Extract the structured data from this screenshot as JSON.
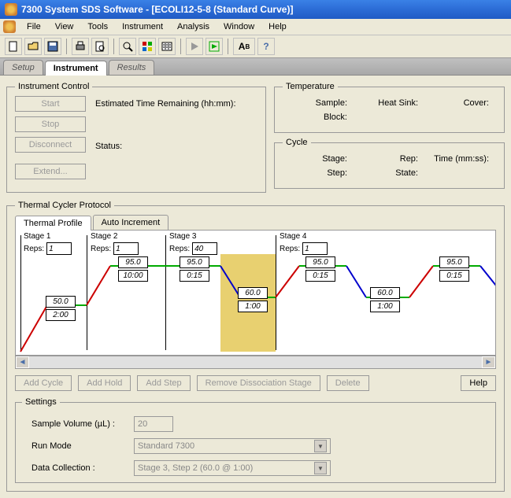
{
  "title": "7300 System SDS Software - [ECOLI12-5-8 (Standard Curve)]",
  "menu": [
    "File",
    "View",
    "Tools",
    "Instrument",
    "Analysis",
    "Window",
    "Help"
  ],
  "tabs": {
    "setup": "Setup",
    "instrument": "Instrument",
    "results": "Results"
  },
  "instctrl": {
    "legend": "Instrument Control",
    "start": "Start",
    "stop": "Stop",
    "disconnect": "Disconnect",
    "extend": "Extend...",
    "estremain": "Estimated Time Remaining (hh:mm):",
    "status": "Status:"
  },
  "temp": {
    "legend": "Temperature",
    "sample": "Sample:",
    "heatsink": "Heat Sink:",
    "cover": "Cover:",
    "block": "Block:"
  },
  "cycle": {
    "legend": "Cycle",
    "stage": "Stage:",
    "rep": "Rep:",
    "time": "Time (mm:ss):",
    "step": "Step:",
    "state": "State:"
  },
  "protocol": {
    "legend": "Thermal Cycler Protocol",
    "thermal": "Thermal Profile",
    "autoinc": "Auto Increment",
    "replabel": "Reps:",
    "stages": [
      {
        "name": "Stage 1",
        "reps": "1"
      },
      {
        "name": "Stage 2",
        "reps": "1"
      },
      {
        "name": "Stage 3",
        "reps": "40"
      },
      {
        "name": "Stage 4",
        "reps": "1"
      }
    ],
    "values": {
      "s1_temp": "50.0",
      "s1_time": "2:00",
      "s2_temp": "95.0",
      "s2_time": "10:00",
      "s3a_temp": "95.0",
      "s3a_time": "0:15",
      "s3b_temp": "60.0",
      "s3b_time": "1:00",
      "s4a_temp": "95.0",
      "s4a_time": "0:15",
      "s4b_temp": "60.0",
      "s4b_time": "1:00",
      "s4c_temp": "95.0",
      "s4c_time": "0:15"
    },
    "btns": {
      "addcycle": "Add Cycle",
      "addhold": "Add Hold",
      "addstep": "Add Step",
      "remdiss": "Remove Dissociation Stage",
      "delete": "Delete",
      "help": "Help"
    },
    "settings": {
      "legend": "Settings",
      "samplevol": "Sample Volume (µL) :",
      "samplevol_val": "20",
      "runmode": "Run Mode",
      "runmode_val": "Standard 7300",
      "datacol": "Data Collection :",
      "datacol_val": "Stage 3, Step 2 (60.0 @ 1:00)"
    }
  }
}
